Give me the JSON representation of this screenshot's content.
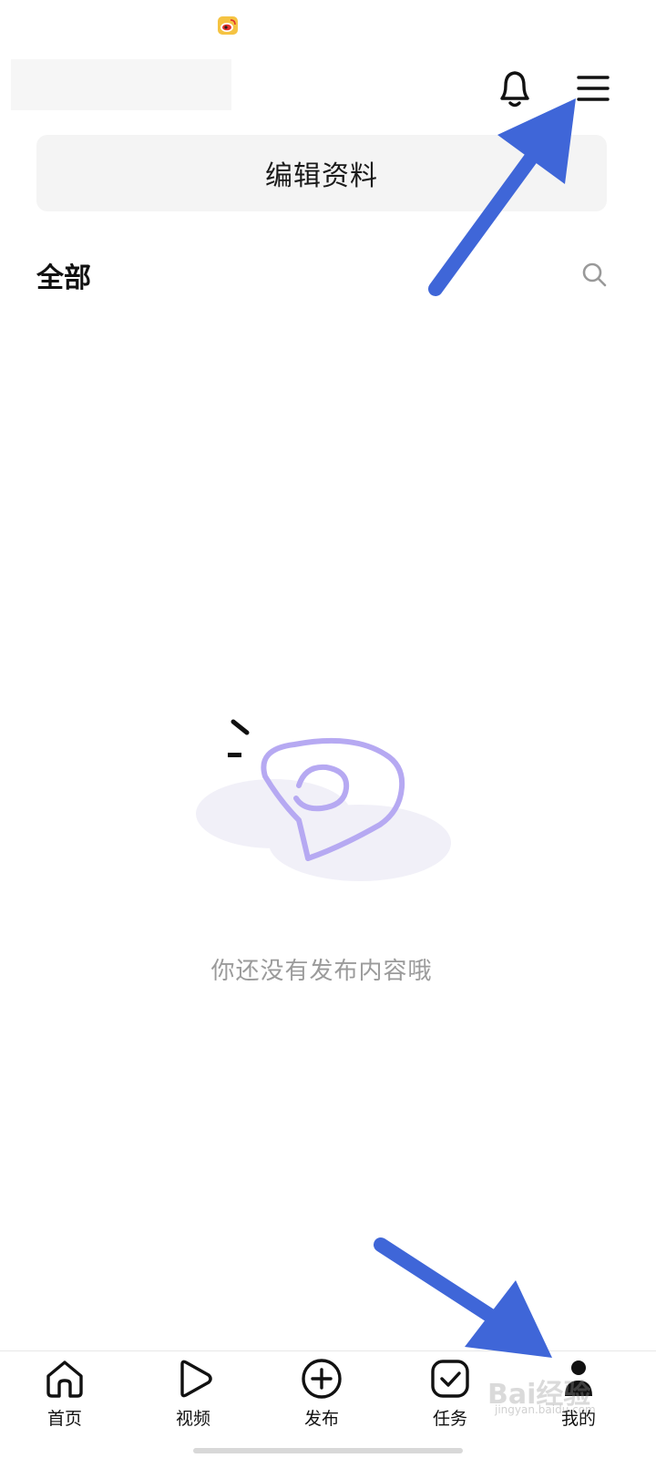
{
  "status_bar": {
    "app_icon": "weibo-icon"
  },
  "header": {
    "notification_icon": "bell-icon",
    "menu_icon": "hamburger-menu-icon"
  },
  "profile": {
    "edit_button_label": "编辑资料"
  },
  "content_section": {
    "title": "全部",
    "search_icon": "search-icon"
  },
  "empty_state": {
    "illustration": "empty-content-illustration",
    "message": "你还没有发布内容哦"
  },
  "bottom_nav": {
    "items": [
      {
        "label": "首页",
        "icon": "home-icon",
        "active": false
      },
      {
        "label": "视频",
        "icon": "play-icon",
        "active": false
      },
      {
        "label": "发布",
        "icon": "plus-circle-icon",
        "active": false
      },
      {
        "label": "任务",
        "icon": "check-box-icon",
        "active": false
      },
      {
        "label": "我的",
        "icon": "person-icon",
        "active": true
      }
    ]
  },
  "annotations": {
    "arrow_color": "#3f66d8",
    "watermark_text": "Bai经验",
    "watermark_url": "jingyan.baidu.com"
  },
  "colors": {
    "background": "#ffffff",
    "button_bg": "#f4f4f4",
    "muted_text": "#9b9b9b",
    "illustration_stroke": "#b6a9f2",
    "illustration_shadow": "#f1f0f8"
  }
}
